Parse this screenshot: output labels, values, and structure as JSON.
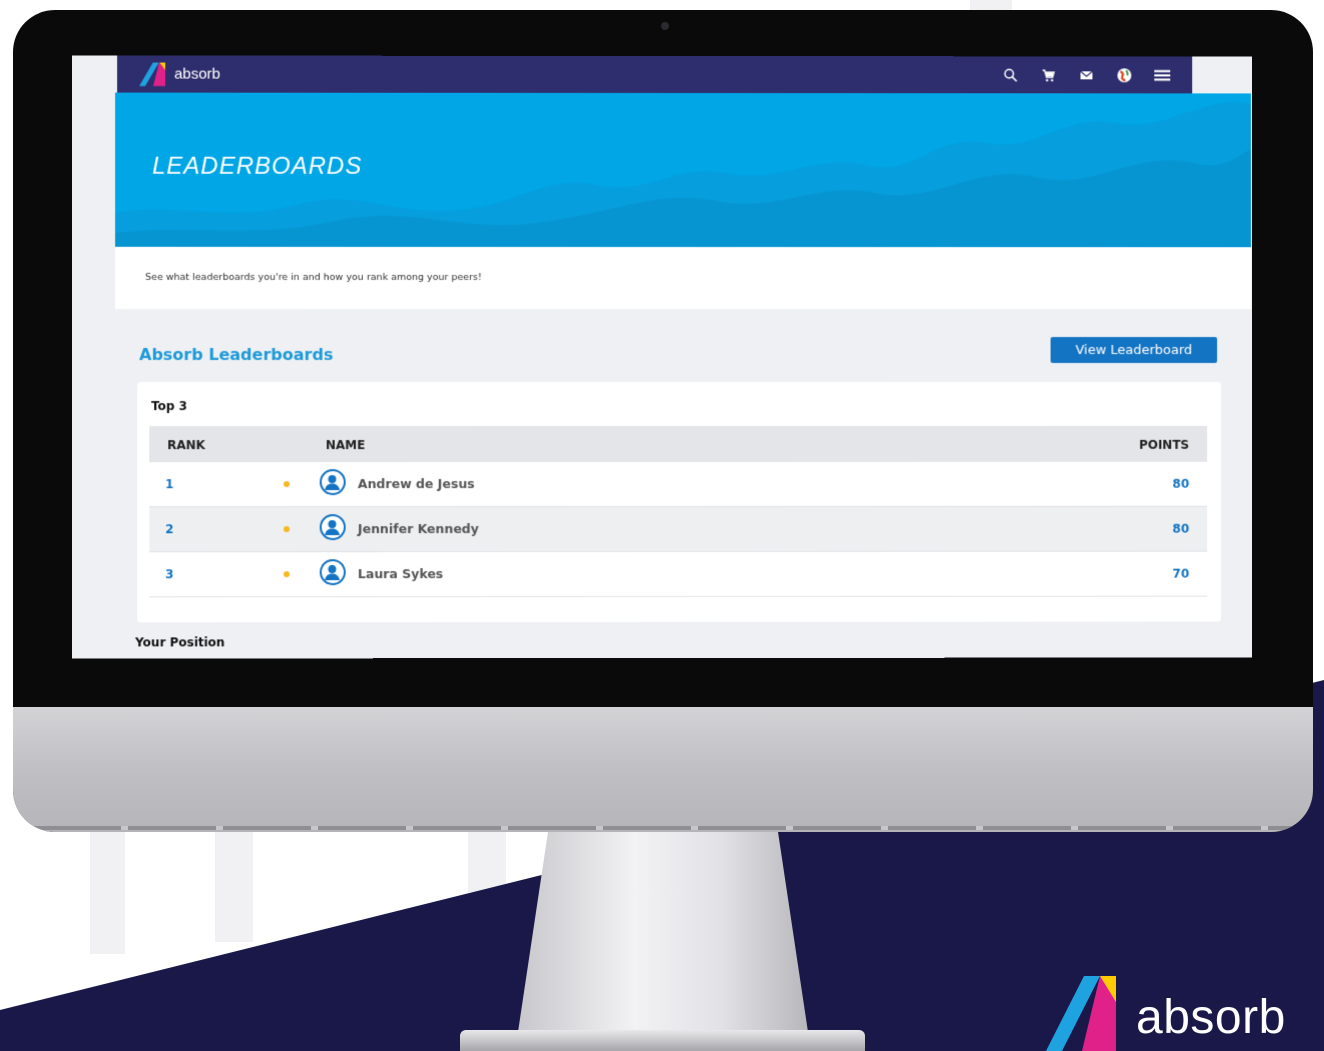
{
  "app": {
    "brand": "absorb",
    "colors": {
      "nav": "#2e2d6e",
      "hero": "#00a6e6",
      "accent": "#1474c4",
      "title": "#1e9ad8",
      "medal": "#f7b81e",
      "navy_background": "#1a1848"
    }
  },
  "nav": {
    "icons": [
      "search-icon",
      "cart-icon",
      "mail-icon",
      "globe-icon",
      "menu-icon"
    ]
  },
  "hero": {
    "title": "LEADERBOARDS"
  },
  "intro": {
    "text": "See what leaderboards you're in and how you rank among your peers!"
  },
  "section": {
    "title": "Absorb Leaderboards",
    "view_button": "View Leaderboard"
  },
  "top3": {
    "title": "Top 3",
    "columns": {
      "rank": "RANK",
      "name": "NAME",
      "points": "POINTS"
    },
    "rows": [
      {
        "rank": "1",
        "name": "Andrew de Jesus",
        "points": "80"
      },
      {
        "rank": "2",
        "name": "Jennifer Kennedy",
        "points": "80"
      },
      {
        "rank": "3",
        "name": "Laura Sykes",
        "points": "70"
      }
    ]
  },
  "your_position": {
    "title": "Your Position"
  },
  "footer_brand": {
    "text": "absorb"
  }
}
